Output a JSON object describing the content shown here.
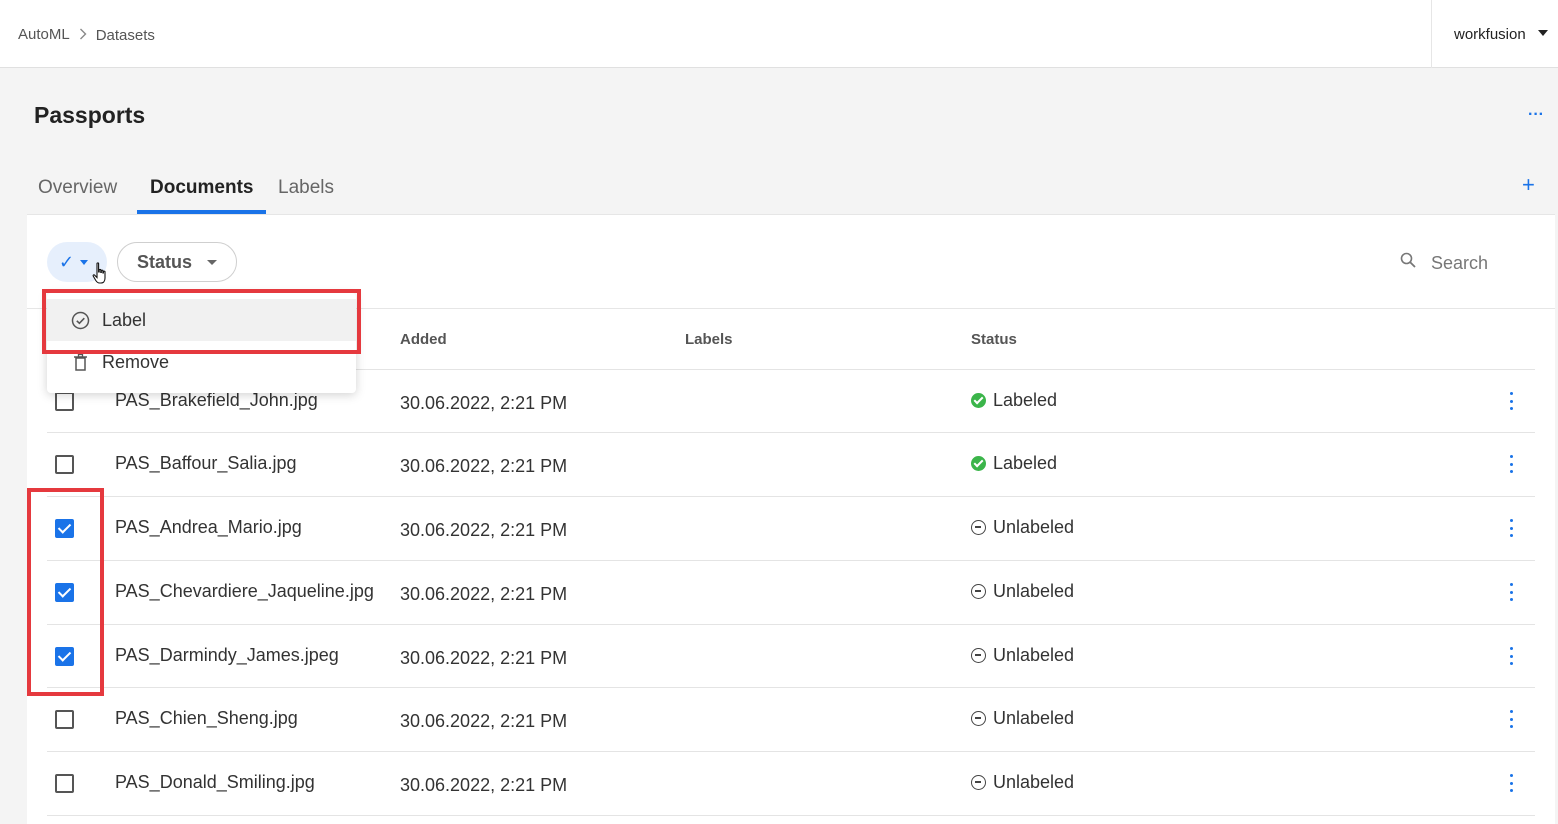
{
  "breadcrumb": {
    "root": "AutoML",
    "current": "Datasets"
  },
  "account": {
    "name": "workfusion"
  },
  "page": {
    "title": "Passports"
  },
  "tabs": [
    {
      "label": "Overview"
    },
    {
      "label": "Documents"
    },
    {
      "label": "Labels"
    }
  ],
  "toolbar": {
    "status_label": "Status",
    "search_placeholder": "Search"
  },
  "menu": {
    "items": [
      {
        "label": "Label",
        "icon": "check-circle-icon"
      },
      {
        "label": "Remove",
        "icon": "trash-icon"
      }
    ]
  },
  "table": {
    "columns": [
      "Added",
      "Labels",
      "Status"
    ],
    "rows": [
      {
        "name": "PAS_Brakefield_John.jpg",
        "added": "30.06.2022, 2:21 PM",
        "status": "Labeled",
        "checked": false
      },
      {
        "name": "PAS_Baffour_Salia.jpg",
        "added": "30.06.2022, 2:21 PM",
        "status": "Labeled",
        "checked": false
      },
      {
        "name": "PAS_Andrea_Mario.jpg",
        "added": "30.06.2022, 2:21 PM",
        "status": "Unlabeled",
        "checked": true
      },
      {
        "name": "PAS_Chevardiere_Jaqueline.jpg",
        "added": "30.06.2022, 2:21 PM",
        "status": "Unlabeled",
        "checked": true
      },
      {
        "name": "PAS_Darmindy_James.jpeg",
        "added": "30.06.2022, 2:21 PM",
        "status": "Unlabeled",
        "checked": true
      },
      {
        "name": "PAS_Chien_Sheng.jpg",
        "added": "30.06.2022, 2:21 PM",
        "status": "Unlabeled",
        "checked": false
      },
      {
        "name": "PAS_Donald_Smiling.jpg",
        "added": "30.06.2022, 2:21 PM",
        "status": "Unlabeled",
        "checked": false
      }
    ]
  },
  "colors": {
    "accent": "#1a73e8",
    "highlight": "#e5393e",
    "labeled": "#3bb54a"
  }
}
